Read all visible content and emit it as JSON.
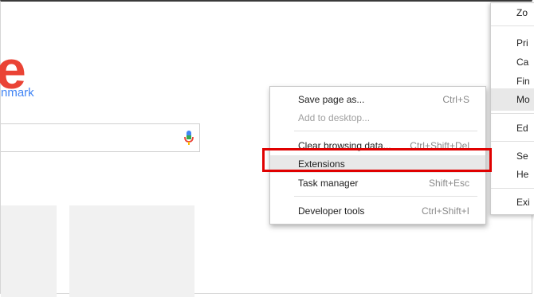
{
  "page": {
    "logo_fragment": "e",
    "tagline_fragment": "nmark"
  },
  "main_menu": {
    "items": [
      "Zo",
      "Pri",
      "Ca",
      "Fin",
      "Mo",
      "Ed",
      "Se",
      "He",
      "Exi"
    ],
    "highlighted": "Mo"
  },
  "more_tools_menu": {
    "items": [
      {
        "label": "Save page as...",
        "shortcut": "Ctrl+S",
        "enabled": true
      },
      {
        "label": "Add to desktop...",
        "shortcut": "",
        "enabled": false
      },
      {
        "label": "Clear browsing data...",
        "shortcut": "Ctrl+Shift+Del",
        "enabled": true
      },
      {
        "label": "Extensions",
        "shortcut": "",
        "enabled": true,
        "highlighted": true
      },
      {
        "label": "Task manager",
        "shortcut": "Shift+Esc",
        "enabled": true
      },
      {
        "label": "Developer tools",
        "shortcut": "Ctrl+Shift+I",
        "enabled": true
      }
    ]
  },
  "colors": {
    "logo": "#ea4335",
    "link": "#4285f4",
    "annotation": "#e00000"
  }
}
